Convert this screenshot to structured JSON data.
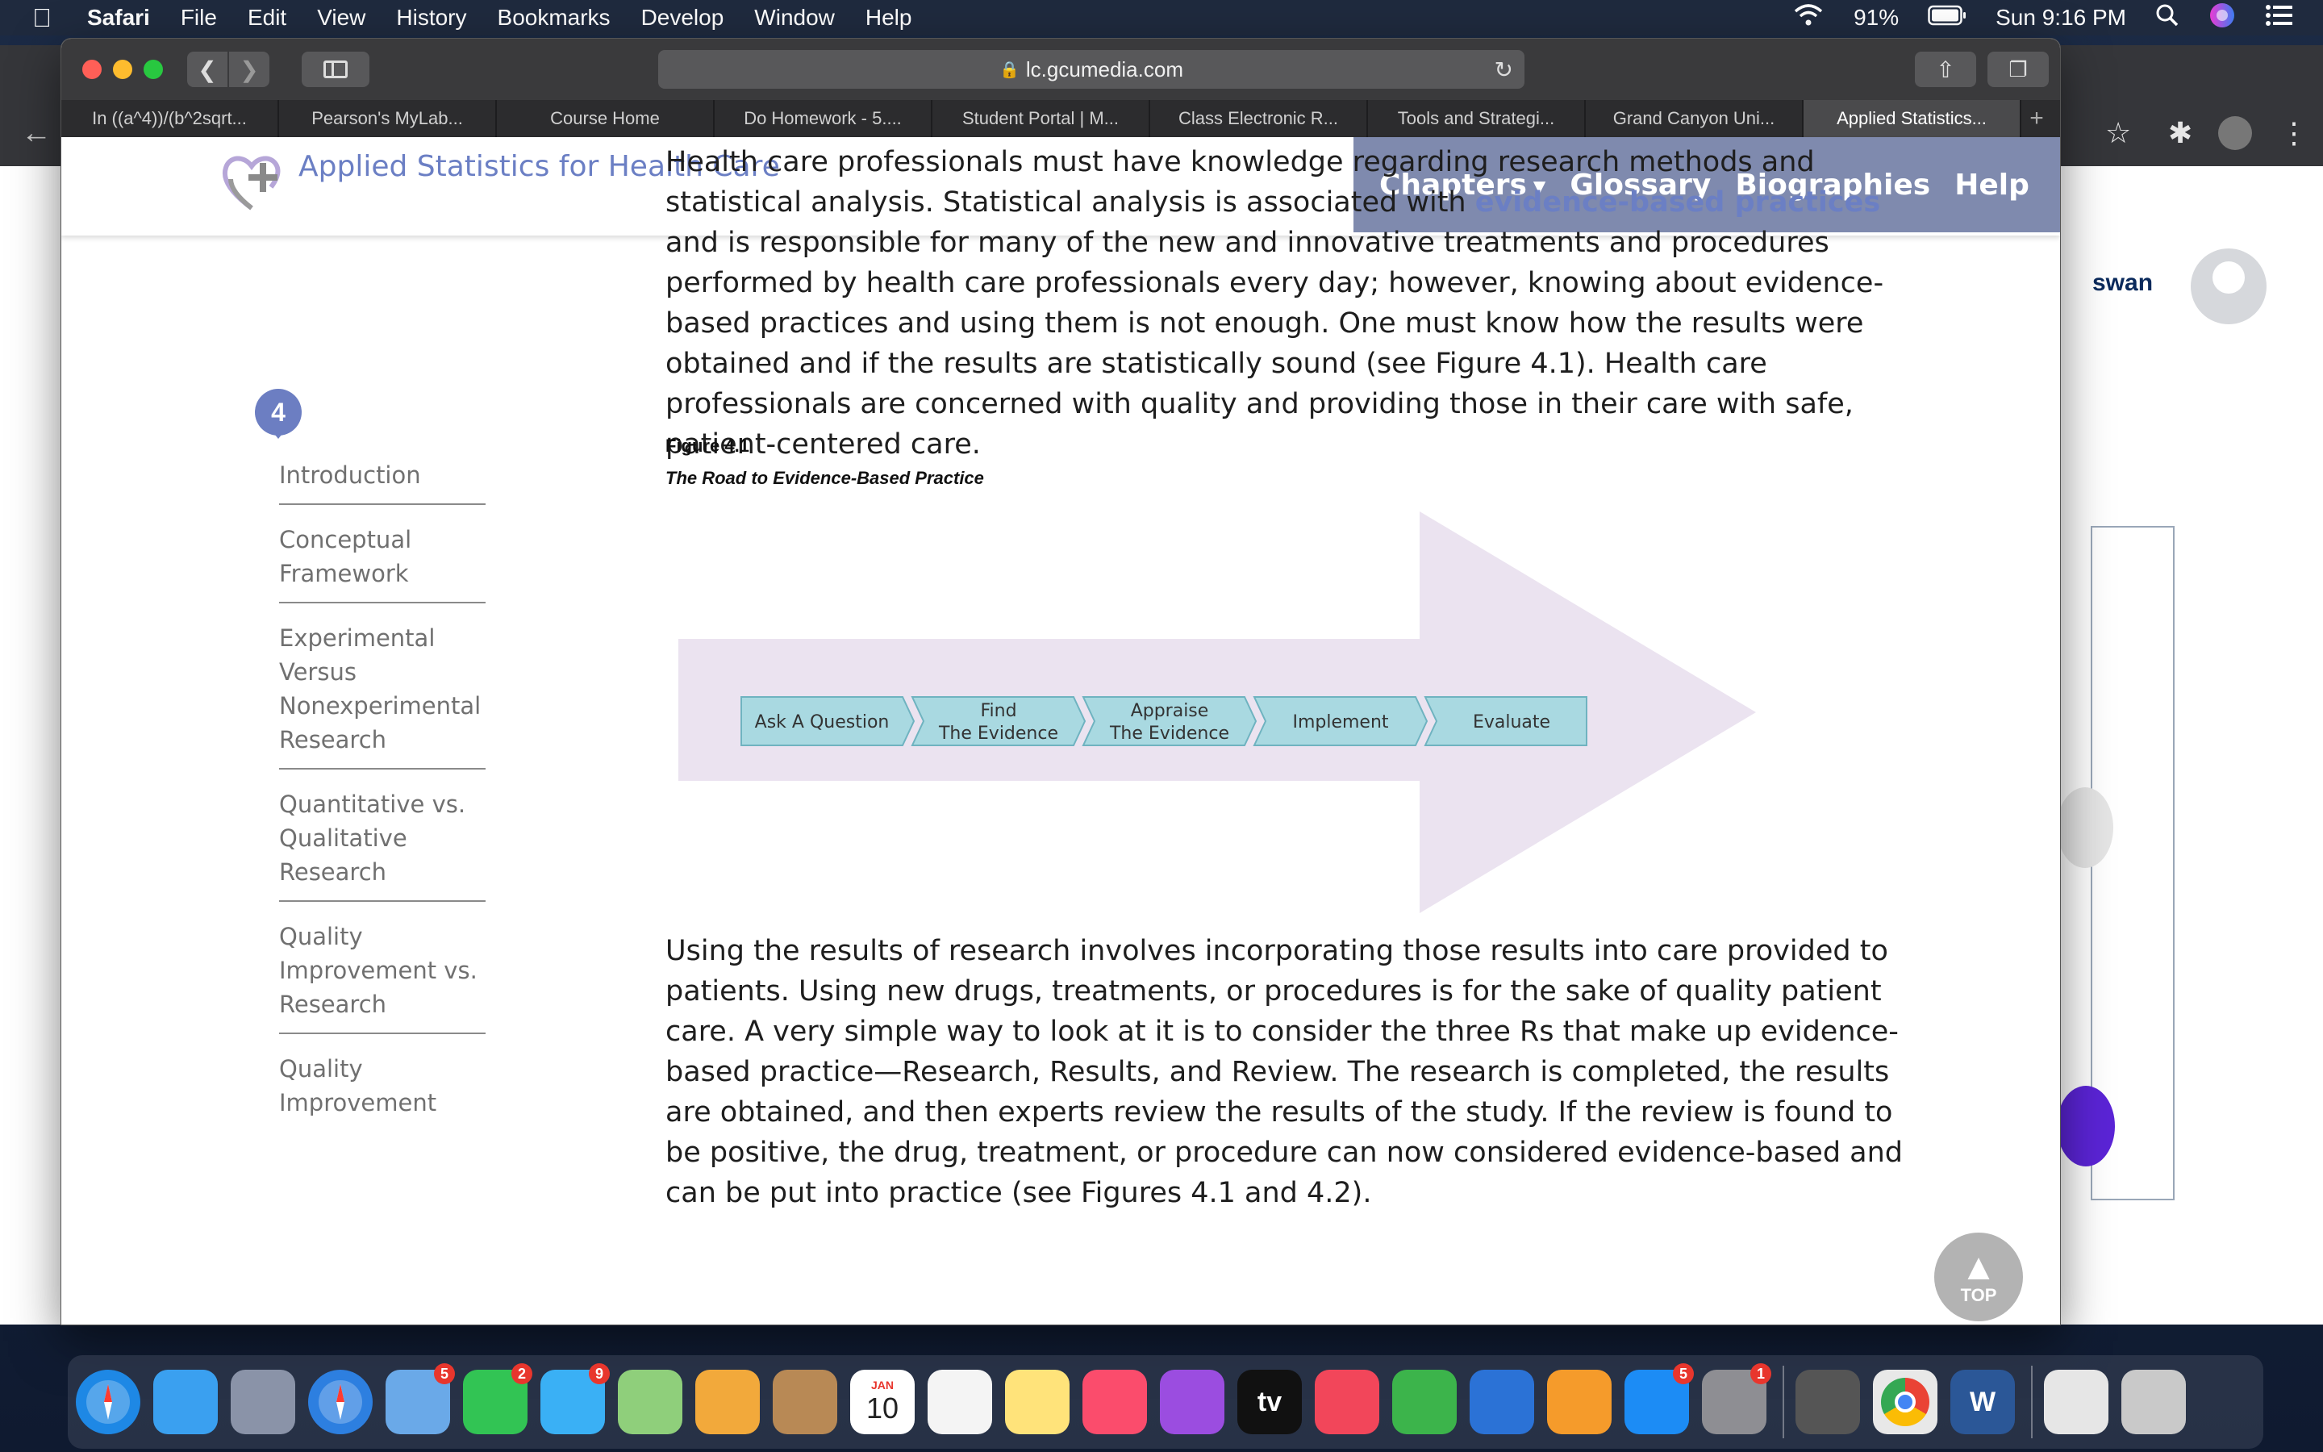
{
  "menubar": {
    "app": "Safari",
    "items": [
      "File",
      "Edit",
      "View",
      "History",
      "Bookmarks",
      "Develop",
      "Window",
      "Help"
    ],
    "battery": "91%",
    "clock": "Sun 9:16 PM"
  },
  "safari": {
    "url": "lc.gcumedia.com",
    "tabs": [
      "In ((a^4))/(b^2sqrt...",
      "Pearson's MyLab...",
      "Course Home",
      "Do Homework - 5....",
      "Student Portal | M...",
      "Class Electronic R...",
      "Tools and Strategi...",
      "Grand Canyon Uni...",
      "Applied Statistics..."
    ],
    "active_tab_index": 8
  },
  "background_page": {
    "user_name_fragment": "swan"
  },
  "site": {
    "title": "Applied Statistics for Health Care",
    "nav": [
      "Chapters",
      "Glossary",
      "Biographies",
      "Help"
    ],
    "accent_color": "#6b7fc4",
    "nav_bg_color": "#7f8aae"
  },
  "chapter": {
    "number": "4",
    "toc": [
      "Introduction",
      "Conceptual Framework",
      "Experimental Versus Nonexperimental Research",
      "Quantitative vs. Qualitative Research",
      "Quality Improvement vs. Research",
      "Quality Improvement"
    ]
  },
  "article": {
    "para1_before": "Health care professionals must have knowledge regarding research methods and statistical analysis. Statistical analysis is associated with ",
    "para1_link": "evidence-based practices",
    "para1_after": " and is responsible for many of the new and innovative treatments and procedures performed by health care professionals every day; however, knowing about evidence-based practices and using them is not enough. One must know how the results were obtained and if the results are statistically sound (see Figure 4.1). Health care professionals are concerned with quality and providing those in their care with safe, patient-centered care.",
    "figure_number": "Figure 4.1",
    "figure_caption": "The Road to Evidence-Based Practice",
    "figure_steps": [
      [
        "Ask A Question"
      ],
      [
        "Find",
        "The Evidence"
      ],
      [
        "Appraise",
        "The Evidence"
      ],
      [
        "Implement"
      ],
      [
        "Evaluate"
      ]
    ],
    "para2": "Using the results of research involves incorporating those results into care provided to patients. Using new drugs, treatments, or procedures is for the sake of quality patient care. A very simple way to look at it is to consider the three Rs that make up evidence-based practice—Research, Results, and Review. The research is completed, the results are obtained, and then experts review the results of the study. If the review is found to be positive, the drug, treatment, or procedure can now considered evidence-based and can be put into practice (see Figures 4.1 and 4.2).",
    "top_button": "TOP"
  },
  "dock": {
    "apps": [
      {
        "name": "safari-app",
        "color": "#1e88e5",
        "badge": ""
      },
      {
        "name": "finder-app",
        "color": "#3aa0f0",
        "badge": ""
      },
      {
        "name": "launchpad-app",
        "color": "#8a93a8",
        "badge": ""
      },
      {
        "name": "safari-app-2",
        "color": "#2d7fe0",
        "badge": ""
      },
      {
        "name": "mail-app",
        "color": "#6aa9e8",
        "badge": "5"
      },
      {
        "name": "facetime-app",
        "color": "#32c454",
        "badge": "2"
      },
      {
        "name": "messages-app",
        "color": "#3ab0f5",
        "badge": "9"
      },
      {
        "name": "maps-app",
        "color": "#8fcf7b",
        "badge": ""
      },
      {
        "name": "photos-app",
        "color": "#f2a93b",
        "badge": ""
      },
      {
        "name": "contacts-app",
        "color": "#b88955",
        "badge": ""
      },
      {
        "name": "calendar-app",
        "color": "#ffffff",
        "badge": ""
      },
      {
        "name": "reminders-app",
        "color": "#f4f4f4",
        "badge": ""
      },
      {
        "name": "notes-app",
        "color": "#ffe37a",
        "badge": ""
      },
      {
        "name": "music-app",
        "color": "#fb4c6c",
        "badge": ""
      },
      {
        "name": "podcasts-app",
        "color": "#9b4de0",
        "badge": ""
      },
      {
        "name": "tv-app",
        "color": "#111111",
        "badge": ""
      },
      {
        "name": "news-app",
        "color": "#f2465a",
        "badge": ""
      },
      {
        "name": "numbers-app",
        "color": "#3cb44b",
        "badge": ""
      },
      {
        "name": "keynote-app",
        "color": "#2b72d6",
        "badge": ""
      },
      {
        "name": "pages-app",
        "color": "#f59b2b",
        "badge": ""
      },
      {
        "name": "app-store-app",
        "color": "#1c8cf5",
        "badge": "5"
      },
      {
        "name": "system-preferences-app",
        "color": "#8e8e93",
        "badge": "1"
      },
      {
        "name": "calculator-app",
        "color": "#555555",
        "badge": ""
      },
      {
        "name": "chrome-app",
        "color": "#e8e8e8",
        "badge": ""
      },
      {
        "name": "word-app",
        "color": "#2b5797",
        "badge": ""
      },
      {
        "name": "document-stack",
        "color": "#e6e6e6",
        "badge": ""
      },
      {
        "name": "trash-app",
        "color": "#c9c9c9",
        "badge": ""
      }
    ],
    "calendar_month": "JAN",
    "calendar_day": "10",
    "tv_label": "tv",
    "word_label": "W"
  }
}
